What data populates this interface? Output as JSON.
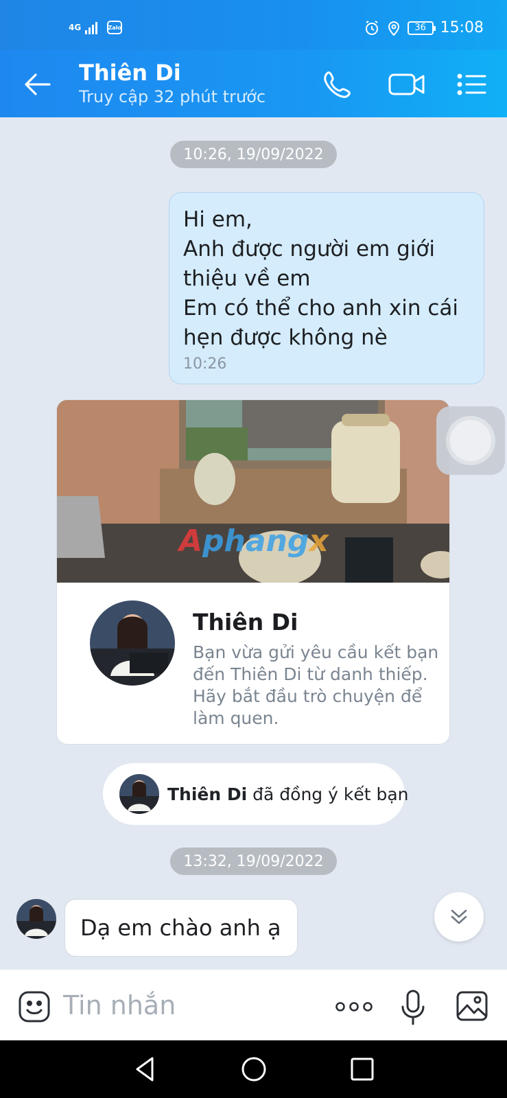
{
  "status_bar": {
    "network": "4G",
    "app_badge": "Zalo",
    "battery": "36",
    "time": "15:08"
  },
  "header": {
    "title": "Thiên Di",
    "subtitle": "Truy cập 32 phút trước"
  },
  "chat": {
    "timestamp_1": "10:26, 19/09/2022",
    "outgoing": {
      "lines": [
        "Hi em,",
        "Anh được người em giới",
        "thiệu về em",
        "Em có thể cho anh xin cái",
        "hẹn được không nè"
      ],
      "time": "10:26"
    },
    "contact_card": {
      "name": "Thiên Di",
      "description": "Bạn vừa gửi yêu cầu kết bạn đến Thiên Di từ danh thiếp. Hãy bắt đầu trò chuyện để làm quen.",
      "watermark": "Aphangx"
    },
    "friend_notice": {
      "name": "Thiên Di",
      "text": "đã đồng ý kết bạn"
    },
    "timestamp_2": "13:32, 19/09/2022",
    "incoming": {
      "text": "Dạ em chào anh ạ"
    }
  },
  "input_bar": {
    "placeholder": "Tin nhắn"
  },
  "icons": {
    "back": "arrow-left-icon",
    "call": "phone-icon",
    "video": "video-camera-icon",
    "menu": "list-menu-icon",
    "emoji": "emoji-icon",
    "more": "more-dots-icon",
    "mic": "microphone-icon",
    "image": "image-icon",
    "scroll": "double-chevron-down-icon"
  },
  "colors": {
    "header_blue": "#1e88f0",
    "chat_bg": "#e2e8f1",
    "outgoing_bubble": "#d5ecfd",
    "time_pill": "#b7bcc3"
  }
}
